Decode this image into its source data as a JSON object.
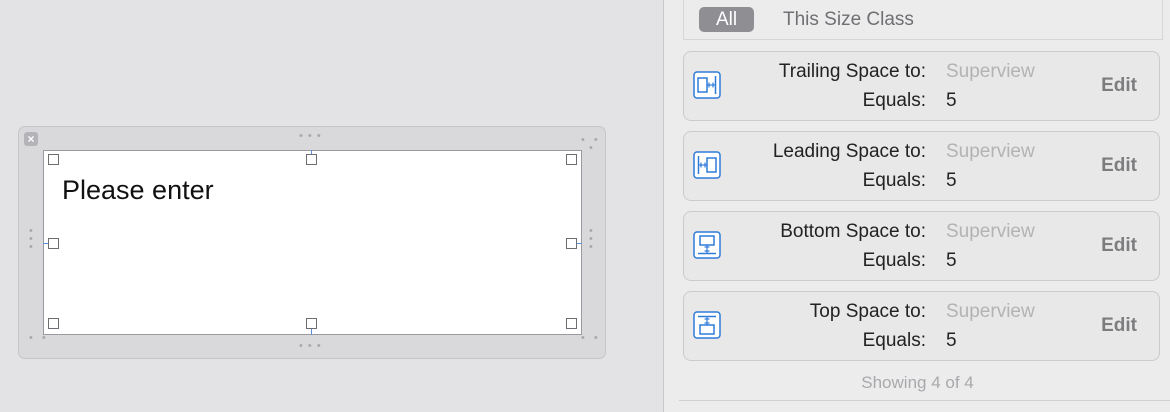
{
  "canvas": {
    "text_field_value": "Please enter"
  },
  "inspector": {
    "filter": {
      "all_label": "All",
      "size_class_label": "This Size Class"
    },
    "constraints": [
      {
        "icon": "trailing-space-icon",
        "label": "Trailing Space to:",
        "target": "Superview",
        "equals_label": "Equals:",
        "value": "5",
        "edit_label": "Edit"
      },
      {
        "icon": "leading-space-icon",
        "label": "Leading Space to:",
        "target": "Superview",
        "equals_label": "Equals:",
        "value": "5",
        "edit_label": "Edit"
      },
      {
        "icon": "bottom-space-icon",
        "label": "Bottom Space to:",
        "target": "Superview",
        "equals_label": "Equals:",
        "value": "5",
        "edit_label": "Edit"
      },
      {
        "icon": "top-space-icon",
        "label": "Top Space to:",
        "target": "Superview",
        "equals_label": "Equals:",
        "value": "5",
        "edit_label": "Edit"
      }
    ],
    "showing": "Showing 4 of 4"
  },
  "colors": {
    "accent": "#2f7bd8",
    "segment_selected": "#8e8e93"
  }
}
